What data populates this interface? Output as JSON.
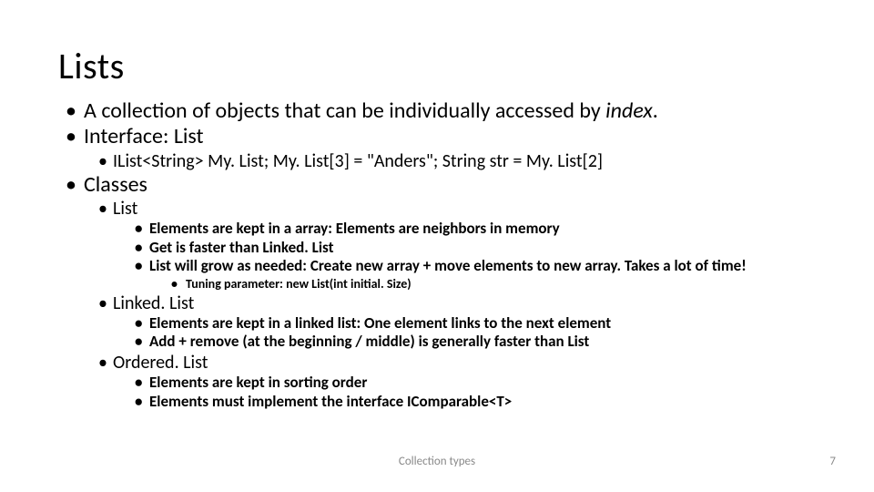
{
  "title": "Lists",
  "bullets": {
    "b1_pre": "A collection of objects that can be individually accessed by ",
    "b1_em": "index",
    "b1_post": ".",
    "b2": "Interface: List",
    "b2_1": "IList<String> My. List;  My. List[3] = \"Anders\"; String str = My. List[2]",
    "b3": "Classes",
    "b3_1": "List",
    "b3_1_1": "Elements are kept in a array: Elements are neighbors in memory",
    "b3_1_2": "Get is faster than Linked. List",
    "b3_1_3": "List will grow as needed: Create new array + move elements to new array. Takes a lot of time!",
    "b3_1_3_1": "Tuning parameter: new List(int initial. Size)",
    "b3_2": "Linked. List",
    "b3_2_1": "Elements are kept in a linked list: One element links to the next element",
    "b3_2_2": "Add + remove (at the beginning / middle) is generally faster than List",
    "b3_3": "Ordered. List",
    "b3_3_1": "Elements are kept in sorting order",
    "b3_3_2": "Elements must implement the interface IComparable<T>"
  },
  "footer": {
    "center": "Collection types",
    "page": "7"
  }
}
